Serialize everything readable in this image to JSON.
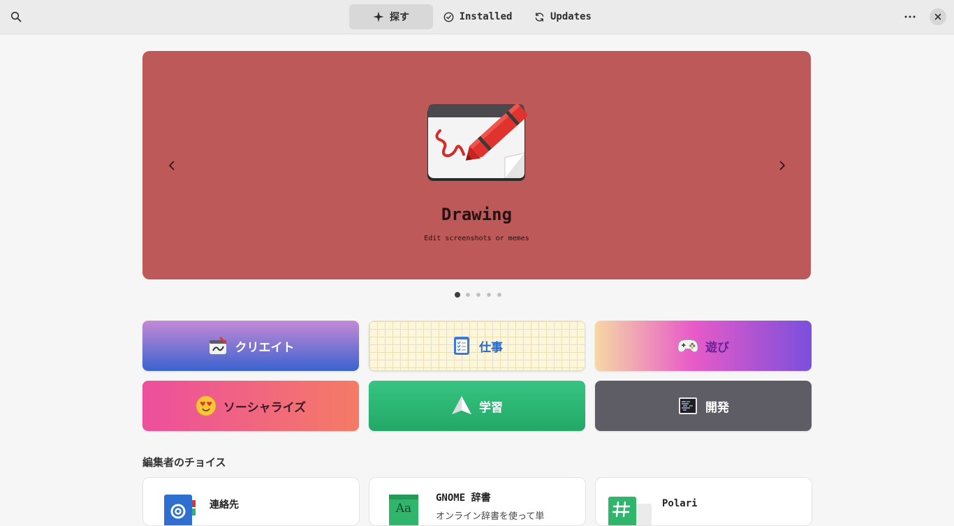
{
  "header": {
    "tabs": [
      {
        "label": "探す",
        "icon": "sparkle-icon",
        "active": true
      },
      {
        "label": "Installed",
        "icon": "check-circle-icon",
        "active": false
      },
      {
        "label": "Updates",
        "icon": "refresh-icon",
        "active": false
      }
    ]
  },
  "banner": {
    "title": "Drawing",
    "subtitle": "Edit screenshots or memes",
    "background": "#bd5959",
    "slides": 5,
    "active_slide": 1
  },
  "categories": [
    {
      "label": "クリエイト",
      "icon": "create-icon"
    },
    {
      "label": "仕事",
      "icon": "work-icon"
    },
    {
      "label": "遊び",
      "icon": "gamepad-icon"
    },
    {
      "label": "ソーシャライズ",
      "icon": "heart-eyes-emoji-icon"
    },
    {
      "label": "学習",
      "icon": "paper-plane-icon"
    },
    {
      "label": "開発",
      "icon": "terminal-icon"
    }
  ],
  "editors_choice": {
    "title": "編集者のチョイス",
    "apps": [
      {
        "name": "連絡先",
        "icon": "contacts-icon"
      },
      {
        "name": "GNOME 辞書",
        "description": "オンライン辞書を使って単",
        "icon": "dictionary-icon"
      },
      {
        "name": "Polari",
        "icon": "polari-icon"
      }
    ]
  }
}
